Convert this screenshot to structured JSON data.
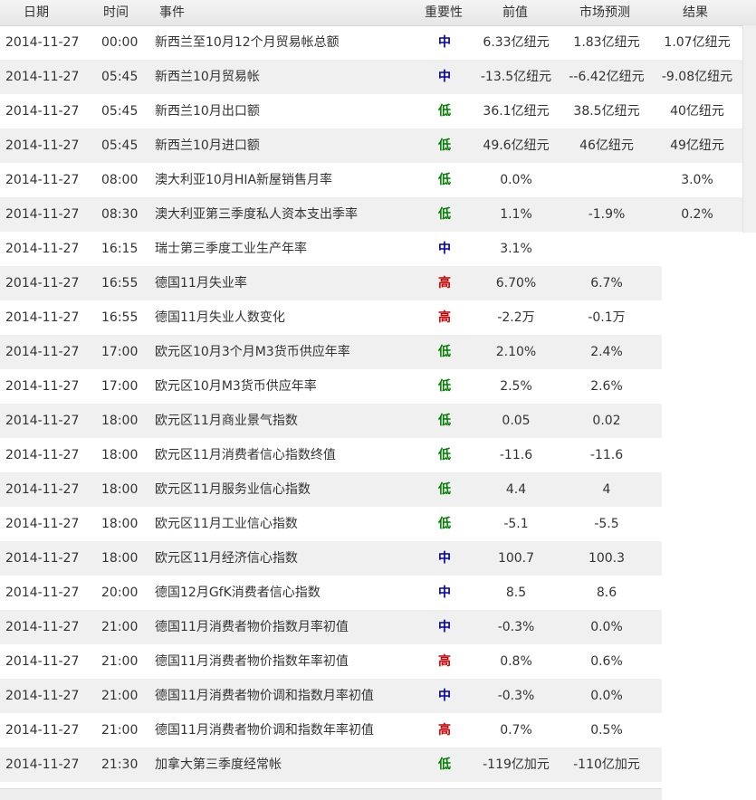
{
  "headers": {
    "date": "日期",
    "time": "时间",
    "event": "事件",
    "importance": "重要性",
    "previous": "前值",
    "forecast": "市场预测",
    "actual": "结果"
  },
  "rows": [
    {
      "date": "2014-11-27",
      "time": "00:00",
      "event": "新西兰至10月12个月贸易帐总额",
      "importance": "中",
      "level": "mid",
      "previous": "6.33亿纽元",
      "forecast": "1.83亿纽元",
      "actual": "1.07亿纽元"
    },
    {
      "date": "2014-11-27",
      "time": "05:45",
      "event": "新西兰10月贸易帐",
      "importance": "中",
      "level": "mid",
      "previous": "-13.5亿纽元",
      "forecast": "--6.42亿纽元",
      "actual": "-9.08亿纽元"
    },
    {
      "date": "2014-11-27",
      "time": "05:45",
      "event": "新西兰10月出口额",
      "importance": "低",
      "level": "low",
      "previous": "36.1亿纽元",
      "forecast": "38.5亿纽元",
      "actual": "40亿纽元"
    },
    {
      "date": "2014-11-27",
      "time": "05:45",
      "event": "新西兰10月进口额",
      "importance": "低",
      "level": "low",
      "previous": "49.6亿纽元",
      "forecast": "46亿纽元",
      "actual": "49亿纽元"
    },
    {
      "date": "2014-11-27",
      "time": "08:00",
      "event": "澳大利亚10月HIA新屋销售月率",
      "importance": "低",
      "level": "low",
      "previous": "0.0%",
      "forecast": "",
      "actual": "3.0%"
    },
    {
      "date": "2014-11-27",
      "time": "08:30",
      "event": "澳大利亚第三季度私人资本支出季率",
      "importance": "低",
      "level": "low",
      "previous": "1.1%",
      "forecast": "-1.9%",
      "actual": "0.2%"
    },
    {
      "date": "2014-11-27",
      "time": "16:15",
      "event": "瑞士第三季度工业生产年率",
      "importance": "中",
      "level": "mid",
      "previous": "3.1%",
      "forecast": "",
      "actual": ""
    },
    {
      "date": "2014-11-27",
      "time": "16:55",
      "event": "德国11月失业率",
      "importance": "高",
      "level": "high",
      "previous": "6.70%",
      "forecast": "6.7%",
      "actual": ""
    },
    {
      "date": "2014-11-27",
      "time": "16:55",
      "event": "德国11月失业人数变化",
      "importance": "高",
      "level": "high",
      "previous": "-2.2万",
      "forecast": "-0.1万",
      "actual": ""
    },
    {
      "date": "2014-11-27",
      "time": "17:00",
      "event": "欧元区10月3个月M3货币供应年率",
      "importance": "低",
      "level": "low",
      "previous": "2.10%",
      "forecast": "2.4%",
      "actual": ""
    },
    {
      "date": "2014-11-27",
      "time": "17:00",
      "event": "欧元区10月M3货币供应年率",
      "importance": "低",
      "level": "low",
      "previous": "2.5%",
      "forecast": "2.6%",
      "actual": ""
    },
    {
      "date": "2014-11-27",
      "time": "18:00",
      "event": "欧元区11月商业景气指数",
      "importance": "低",
      "level": "low",
      "previous": "0.05",
      "forecast": "0.02",
      "actual": ""
    },
    {
      "date": "2014-11-27",
      "time": "18:00",
      "event": "欧元区11月消费者信心指数终值",
      "importance": "低",
      "level": "low",
      "previous": "-11.6",
      "forecast": "-11.6",
      "actual": ""
    },
    {
      "date": "2014-11-27",
      "time": "18:00",
      "event": "欧元区11月服务业信心指数",
      "importance": "低",
      "level": "low",
      "previous": "4.4",
      "forecast": "4",
      "actual": ""
    },
    {
      "date": "2014-11-27",
      "time": "18:00",
      "event": "欧元区11月工业信心指数",
      "importance": "低",
      "level": "low",
      "previous": "-5.1",
      "forecast": "-5.5",
      "actual": ""
    },
    {
      "date": "2014-11-27",
      "time": "18:00",
      "event": "欧元区11月经济信心指数",
      "importance": "中",
      "level": "mid",
      "previous": "100.7",
      "forecast": "100.3",
      "actual": ""
    },
    {
      "date": "2014-11-27",
      "time": "20:00",
      "event": "德国12月GfK消费者信心指数",
      "importance": "中",
      "level": "mid",
      "previous": "8.5",
      "forecast": "8.6",
      "actual": ""
    },
    {
      "date": "2014-11-27",
      "time": "21:00",
      "event": "德国11月消费者物价指数月率初值",
      "importance": "中",
      "level": "mid",
      "previous": "-0.3%",
      "forecast": "0.0%",
      "actual": ""
    },
    {
      "date": "2014-11-27",
      "time": "21:00",
      "event": "德国11月消费者物价指数年率初值",
      "importance": "高",
      "level": "high",
      "previous": "0.8%",
      "forecast": "0.6%",
      "actual": ""
    },
    {
      "date": "2014-11-27",
      "time": "21:00",
      "event": "德国11月消费者物价调和指数月率初值",
      "importance": "中",
      "level": "mid",
      "previous": "-0.3%",
      "forecast": "0.0%",
      "actual": ""
    },
    {
      "date": "2014-11-27",
      "time": "21:00",
      "event": "德国11月消费者物价调和指数年率初值",
      "importance": "高",
      "level": "high",
      "previous": "0.7%",
      "forecast": "0.5%",
      "actual": ""
    },
    {
      "date": "2014-11-27",
      "time": "21:30",
      "event": "加拿大第三季度经常帐",
      "importance": "低",
      "level": "low",
      "previous": "-119亿加元",
      "forecast": "-110亿加元",
      "actual": ""
    }
  ],
  "colors": {
    "high": "#cc0000",
    "mid": "#0000aa",
    "low": "#008000",
    "row_alt": "#f0f0f0"
  }
}
